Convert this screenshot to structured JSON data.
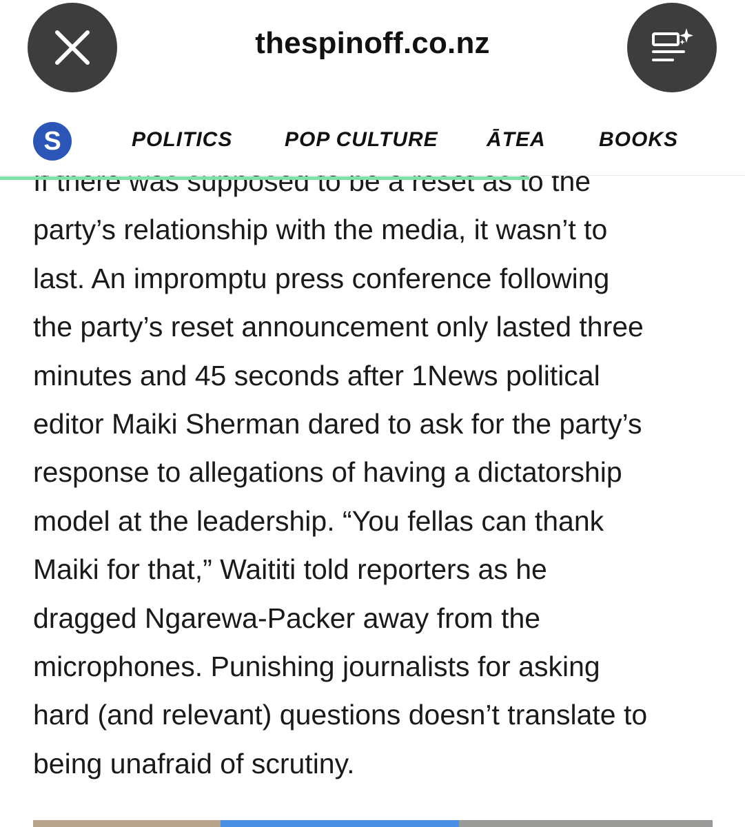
{
  "browser": {
    "url": "thespinoff.co.nz",
    "close_icon": "close-icon",
    "reader_icon": "reader-sparkle-icon"
  },
  "site_nav": {
    "logo_letter": "S",
    "items": [
      {
        "label": "POLITICS"
      },
      {
        "label": "POP CULTURE"
      },
      {
        "label": "ĀTEA"
      },
      {
        "label": "BOOKS"
      }
    ],
    "progress_fraction": 0.71,
    "progress_color": "#7fe0a8"
  },
  "article": {
    "partial_line": "If there was supposed to be a reset as to the",
    "paragraph": "party’s relationship with the media, it wasn’t to\nlast. An impromptu press conference following\nthe party’s reset announcement only lasted three\nminutes and 45 seconds after 1News political\neditor Maiki Sherman dared to ask for the party’s\nresponse to allegations of having a dictatorship\nmodel at the leadership. “You fellas can thank\nMaiki for that,” Waititi told reporters as he\ndragged Ngarewa-Packer away from the\nmicrophones. Punishing journalists for asking\nhard (and relevant) questions doesn’t translate to\nbeing unafraid of scrutiny."
  },
  "colors": {
    "button_bg": "#3d3d3d",
    "logo_bg": "#2c55b8",
    "text": "#1a1a1a"
  }
}
